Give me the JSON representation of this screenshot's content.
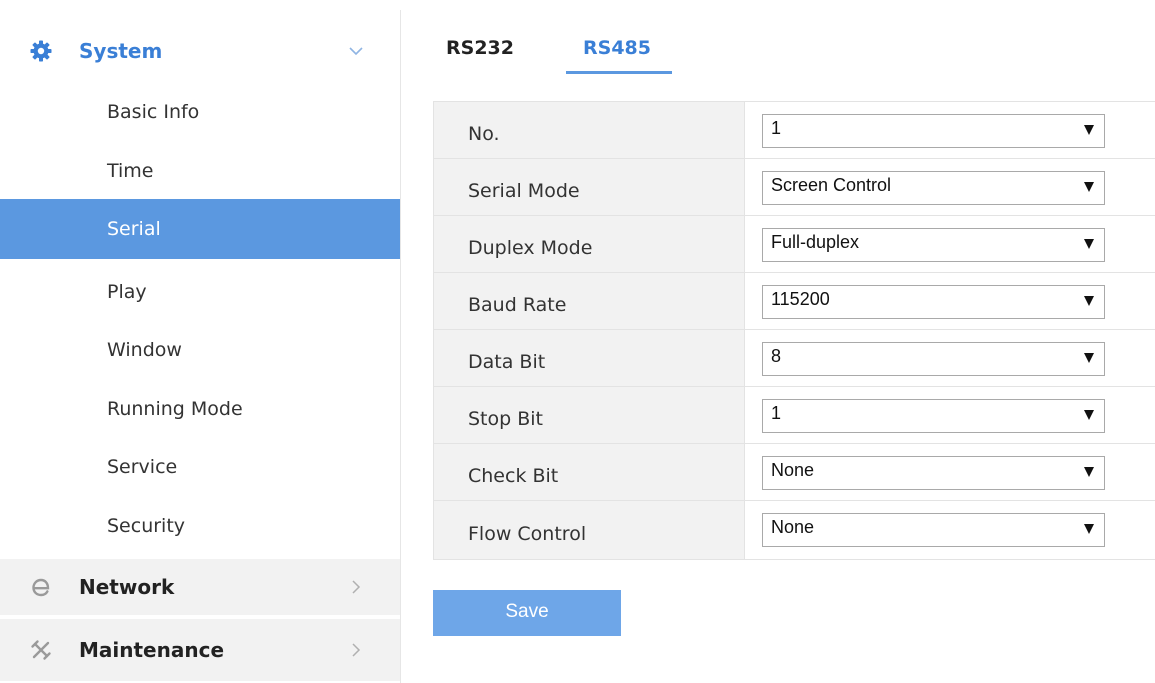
{
  "sidebar": {
    "system": {
      "label": "System",
      "icon": "gear-icon",
      "expanded": true,
      "items": [
        {
          "label": "Basic Info"
        },
        {
          "label": "Time"
        },
        {
          "label": "Serial",
          "active": true
        },
        {
          "label": "Play"
        },
        {
          "label": "Window"
        },
        {
          "label": "Running Mode"
        },
        {
          "label": "Service"
        },
        {
          "label": "Security"
        }
      ]
    },
    "network": {
      "label": "Network",
      "icon": "network-e-icon"
    },
    "maintenance": {
      "label": "Maintenance",
      "icon": "tools-icon"
    }
  },
  "tabs": [
    {
      "label": "RS232",
      "active": false
    },
    {
      "label": "RS485",
      "active": true
    }
  ],
  "form": {
    "rows": [
      {
        "label": "No.",
        "value": "1"
      },
      {
        "label": "Serial Mode",
        "value": "Screen Control"
      },
      {
        "label": "Duplex Mode",
        "value": "Full-duplex"
      },
      {
        "label": "Baud Rate",
        "value": "115200"
      },
      {
        "label": "Data Bit",
        "value": "8"
      },
      {
        "label": "Stop Bit",
        "value": "1"
      },
      {
        "label": "Check Bit",
        "value": "None"
      },
      {
        "label": "Flow Control",
        "value": "None"
      }
    ]
  },
  "actions": {
    "save_label": "Save"
  },
  "colors": {
    "accent": "#3a7fd6",
    "active_item_bg": "#5b98e0",
    "save_button_bg": "#6ea6e8",
    "label_cell_bg": "#f2f2f2"
  }
}
